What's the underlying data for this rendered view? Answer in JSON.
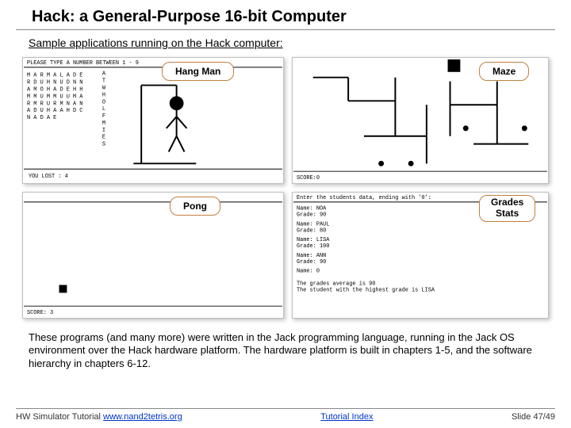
{
  "title": "Hack: a General-Purpose 16-bit Computer",
  "subtitle": "Sample applications running on the Hack computer:",
  "tags": {
    "hangman": "Hang Man",
    "maze": "Maze",
    "pong": "Pong",
    "grades_line1": "Grades",
    "grades_line2": "Stats"
  },
  "hangman": {
    "prompt": "PLEASE TYPE A NUMBER BETWEEN 1 - 9",
    "board_rows": [
      "M A R M A L A D E",
      "R D U H N U D N N",
      "A M O H A D E H H",
      "M M U M M U U M A",
      "R M R U R M N A N",
      "A D U H A A H D C",
      "N A D A       E"
    ],
    "used_letters": "ATWHOLFMIES",
    "lost_text": "YOU LOST   : 4"
  },
  "maze": {
    "score": "SCORE:0"
  },
  "pong": {
    "score": "SCORE: 3"
  },
  "grades": {
    "header": "Enter the students data, ending with '0':",
    "lines": [
      "Name: NOA",
      "Grade: 90",
      "",
      "Name: PAUL",
      "Grade: 80",
      "",
      "Name: LISA",
      "Grade: 100",
      "",
      "Name: ANN",
      "Grade: 90",
      "",
      "Name: 0",
      "",
      "The grades average is 90",
      "The student with the highest grade is LISA"
    ]
  },
  "body_text": "These programs (and many more) were written in the Jack programming language, running in the Jack OS environment over the Hack hardware platform. The hardware platform is built in chapters 1-5, and the software hierarchy in chapters 6-12.",
  "footer": {
    "left_prefix": "HW Simulator Tutorial ",
    "left_link": "www.nand2tetris.org",
    "mid_link": "Tutorial Index",
    "right": "Slide 47/49"
  }
}
